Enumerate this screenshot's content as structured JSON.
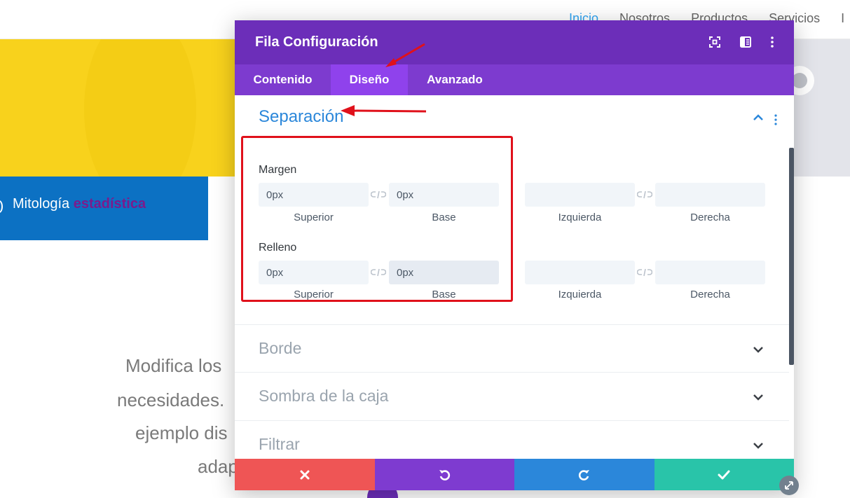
{
  "site": {
    "nav": [
      "Inicio",
      "Nosotros",
      "Productos",
      "Servicios",
      "I"
    ],
    "band_text_plain": "Mitología",
    "band_text_highlight": "estadística",
    "body_lines": [
      "Modifica los",
      "necesidades.",
      "ejemplo dis",
      "adap"
    ]
  },
  "modal": {
    "title": "Fila Configuración",
    "header_icons": [
      "fullscreen-icon",
      "sidebar-toggle-icon",
      "more-options-icon"
    ],
    "tabs": [
      {
        "label": "Contenido",
        "active": false
      },
      {
        "label": "Diseño",
        "active": true
      },
      {
        "label": "Avanzado",
        "active": false
      }
    ],
    "section": {
      "title": "Separación",
      "margin": {
        "label": "Margen",
        "fields": [
          {
            "value": "0px",
            "sub": "Superior"
          },
          {
            "value": "0px",
            "sub": "Base"
          },
          {
            "value": "",
            "sub": "Izquierda"
          },
          {
            "value": "",
            "sub": "Derecha"
          }
        ]
      },
      "padding": {
        "label": "Relleno",
        "fields": [
          {
            "value": "0px",
            "sub": "Superior"
          },
          {
            "value": "0px",
            "sub": "Base"
          },
          {
            "value": "",
            "sub": "Izquierda"
          },
          {
            "value": "",
            "sub": "Derecha"
          }
        ]
      }
    },
    "accordions": [
      "Borde",
      "Sombra de la caja",
      "Filtrar"
    ],
    "footer_buttons": [
      {
        "name": "cancel",
        "icon": "close-icon",
        "color": "#ef5555"
      },
      {
        "name": "undo",
        "icon": "undo-icon",
        "color": "#7e3bd0"
      },
      {
        "name": "redo",
        "icon": "redo-icon",
        "color": "#2b87da"
      },
      {
        "name": "save",
        "icon": "check-icon",
        "color": "#29c4a9"
      }
    ]
  },
  "colors": {
    "header_purple": "#6c2eb9",
    "tabs_purple": "#7d3bcf",
    "active_tab": "#8f42ec",
    "section_blue": "#2b87da",
    "annotation_red": "#e0111b"
  }
}
